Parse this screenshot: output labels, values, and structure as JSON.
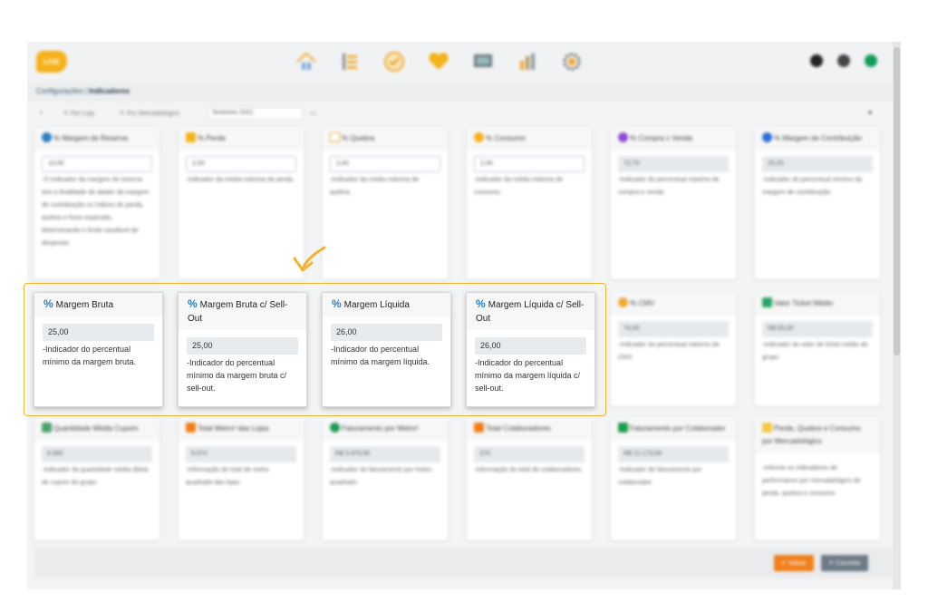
{
  "app": {
    "logo_text": "LIVE",
    "nav_icons": [
      "home-icon",
      "list-icon",
      "clock-icon",
      "heart-icon",
      "monitor-icon",
      "chart-icon",
      "gear-icon"
    ],
    "right_icons": [
      "bell-icon",
      "user-icon",
      "status-icon"
    ]
  },
  "breadcrumb": {
    "parent": "Configurações",
    "separator": " | ",
    "current": "Indicadores"
  },
  "toolbar": {
    "by_store": "Por Loja",
    "by_category": "Por Mercadológico",
    "date": "fevereiro 2021"
  },
  "cards": {
    "reserva": {
      "title": "% Margem de Reserva",
      "value": "10,00",
      "desc": "-O Indicador da margem de reserva tem a finalidade de abater da margem de contribuição os índices de perda, quebra e furos esperado, determinando o limite saudável de despesas"
    },
    "perda": {
      "title": "% Perda",
      "value": "2,50",
      "desc": "-Indicador da média máxima de perda."
    },
    "quebra": {
      "title": "% Quebra",
      "value": "2,00",
      "desc": "-Indicador da média máxima de quebra."
    },
    "consumo": {
      "title": "% Consumo",
      "value": "2,00",
      "desc": "-Indicador da média máxima de consumo."
    },
    "compra_venda": {
      "title": "% Compra x Venda",
      "value": "72,70",
      "desc": "-Indicador do percentual máximo de compra e venda."
    },
    "contribuicao": {
      "title": "% Margem de Contribuição",
      "value": "25,20",
      "desc": "-Indicador do percentual mínimo da margem de contribuição."
    },
    "cmv": {
      "title": "% CMV",
      "value": "74,00",
      "desc": "-Indicador do percentual máximo de CMV."
    },
    "ticket": {
      "title": "Valor Ticket Médio",
      "value": "R$ 55,00",
      "desc": "-Indicador do valor de ticket médio do grupo."
    },
    "cupom": {
      "title": "Quantidade Média Cupom",
      "value": "8.300",
      "desc": "-Indicador da quantidade média diária de cupom do grupo."
    },
    "metro": {
      "title": "Total Metro² das Lojas",
      "value": "5.074",
      "desc": "-Informação do total de metro quadrado das lojas."
    },
    "fat_metro": {
      "title": "Faturamento por Metro²",
      "value": "R$ 3.470,00",
      "desc": "-Indicador do faturamento por metro quadrado."
    },
    "colab": {
      "title": "Total Colaboradores",
      "value": "370",
      "desc": "-Informação do total de colaboradores."
    },
    "fat_colab": {
      "title": "Faturamento por Colaborador",
      "value": "R$ 12.173,00",
      "desc": "-Indicador de faturamento por colaborador."
    },
    "pqc": {
      "title": "Perda, Quebra e Consumo por Mercadológico",
      "desc": "-Informe os indicadores de performance por mercadológico de perda, quebra e consumo."
    }
  },
  "highlighted": [
    {
      "title": "Margem Bruta",
      "value": "25,00",
      "desc": "-Indicador do percentual mínimo da margem bruta."
    },
    {
      "title": "Margem Bruta c/ Sell-Out",
      "value": "25,00",
      "desc": "-Indicador do percentual mínimo da margem bruta c/ sell-out."
    },
    {
      "title": "Margem Líquida",
      "value": "26,00",
      "desc": "-Indicador do percentual mínimo da margem líquida."
    },
    {
      "title": "Margem Líquida c/ Sell-Out",
      "value": "26,00",
      "desc": "-Indicador do percentual mínimo da margem líquida c/ sell-out."
    }
  ],
  "footer": {
    "save": "Salvar",
    "cancel": "Cancelar"
  },
  "colors": {
    "accent": "#f2b233",
    "percent_icon": "#2a7fc4",
    "save": "#f07f1a",
    "cancel": "#6c7a86"
  }
}
